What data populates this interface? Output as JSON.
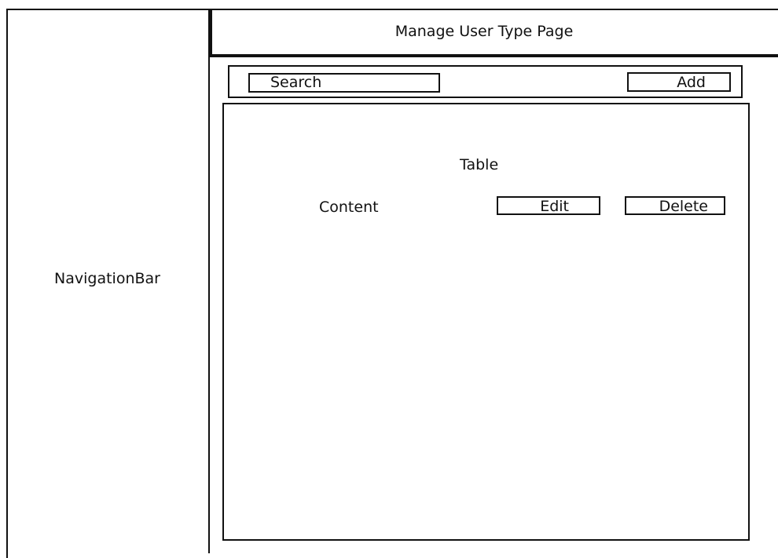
{
  "navigation": {
    "label": "NavigationBar"
  },
  "header": {
    "title": "Manage User Type Page"
  },
  "toolbar": {
    "search_label": "Search",
    "add_label": "Add"
  },
  "table": {
    "title": "Table",
    "row": {
      "content": "Content",
      "edit_label": "Edit",
      "delete_label": "Delete"
    }
  }
}
